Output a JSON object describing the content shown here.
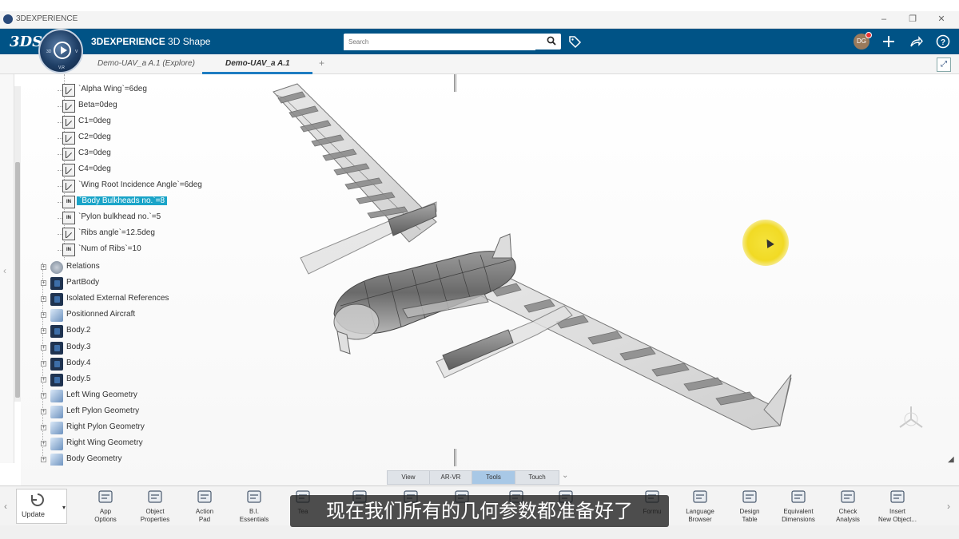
{
  "window": {
    "title": "3DEXPERIENCE",
    "controls": [
      "–",
      "❐",
      "✕"
    ]
  },
  "header": {
    "brand": "3DS",
    "app_bold": "3DEXPERIENCE",
    "app_name": " 3D Shape",
    "search_placeholder": "Search",
    "avatar_initials": "DG",
    "compass_labels": {
      "left": "3D",
      "top": "",
      "right": "V",
      "bottom": "V,R"
    }
  },
  "tabs": [
    {
      "label": "Demo-UAV_a A.1 (Explore)",
      "active": false
    },
    {
      "label": "Demo-UAV_a A.1",
      "active": true
    }
  ],
  "tree": {
    "parameters": [
      {
        "label": "`Alpha Wing`=6deg",
        "icon": "angle-param-icon"
      },
      {
        "label": "Beta=0deg",
        "icon": "angle-param-icon"
      },
      {
        "label": "C1=0deg",
        "icon": "angle-param-icon"
      },
      {
        "label": "C2=0deg",
        "icon": "angle-param-icon"
      },
      {
        "label": "C3=0deg",
        "icon": "angle-param-icon"
      },
      {
        "label": "C4=0deg",
        "icon": "angle-param-icon"
      },
      {
        "label": "`Wing Root Incidence Angle`=6deg",
        "icon": "angle-param-icon"
      },
      {
        "label": "`Body Bulkheads no.`=8",
        "icon": "integer-param-icon",
        "selected": true
      },
      {
        "label": "`Pylon bulkhead no.`=5",
        "icon": "integer-param-icon"
      },
      {
        "label": "`Ribs angle`=12.5deg",
        "icon": "angle-param-icon"
      },
      {
        "label": "`Num of Ribs`=10",
        "icon": "integer-param-icon"
      }
    ],
    "nodes": [
      {
        "label": "Relations",
        "icon": "relations-icon"
      },
      {
        "label": "PartBody",
        "icon": "body-icon"
      },
      {
        "label": "Isolated External References",
        "icon": "body-icon"
      },
      {
        "label": "Positionned Aircraft",
        "icon": "geometry-icon"
      },
      {
        "label": "Body.2",
        "icon": "body-icon"
      },
      {
        "label": "Body.3",
        "icon": "body-icon"
      },
      {
        "label": "Body.4",
        "icon": "body-icon"
      },
      {
        "label": "Body.5",
        "icon": "body-icon"
      },
      {
        "label": "Left Wing Geometry",
        "icon": "geometry-icon"
      },
      {
        "label": "Left Pylon Geometry",
        "icon": "geometry-icon"
      },
      {
        "label": "Right Pylon Geometry",
        "icon": "geometry-icon"
      },
      {
        "label": "Right Wing Geometry",
        "icon": "geometry-icon"
      },
      {
        "label": "Body Geometry",
        "icon": "geometry-icon"
      }
    ]
  },
  "view_tabs": [
    {
      "label": "View",
      "active": false
    },
    {
      "label": "AR-VR",
      "active": false
    },
    {
      "label": "Tools",
      "active": true
    },
    {
      "label": "Touch",
      "active": false
    }
  ],
  "action_bar": {
    "update_label": "Update",
    "actions": [
      {
        "label": "App\nOptions",
        "icon": "app-options-icon"
      },
      {
        "label": "Object\nProperties",
        "icon": "object-properties-icon"
      },
      {
        "label": "Action\nPad",
        "icon": "action-pad-icon"
      },
      {
        "label": "B.I.\nEssentials",
        "icon": "bi-essentials-icon"
      },
      {
        "label": "Tea",
        "icon": "star-icon"
      },
      {
        "label": "",
        "icon": "document-icon"
      },
      {
        "label": "",
        "icon": "branch-icon"
      },
      {
        "label": "",
        "icon": "measure-icon"
      },
      {
        "label": "",
        "icon": "tool-icon"
      },
      {
        "label": "",
        "icon": "sphere-icon"
      },
      {
        "label": "Formu",
        "icon": "formula-icon"
      },
      {
        "label": "Language\nBrowser",
        "icon": "language-browser-icon"
      },
      {
        "label": "Design\nTable",
        "icon": "design-table-icon"
      },
      {
        "label": "Equivalent\nDimensions",
        "icon": "equivalent-dimensions-icon"
      },
      {
        "label": "Check\nAnalysis",
        "icon": "check-analysis-icon"
      },
      {
        "label": "Insert\nNew Object...",
        "icon": "insert-object-icon"
      }
    ]
  },
  "subtitle": "现在我们所有的几何参数都准备好了",
  "colors": {
    "header": "#005386",
    "accent": "#1e7dc2",
    "selection": "#1aa4c8"
  }
}
